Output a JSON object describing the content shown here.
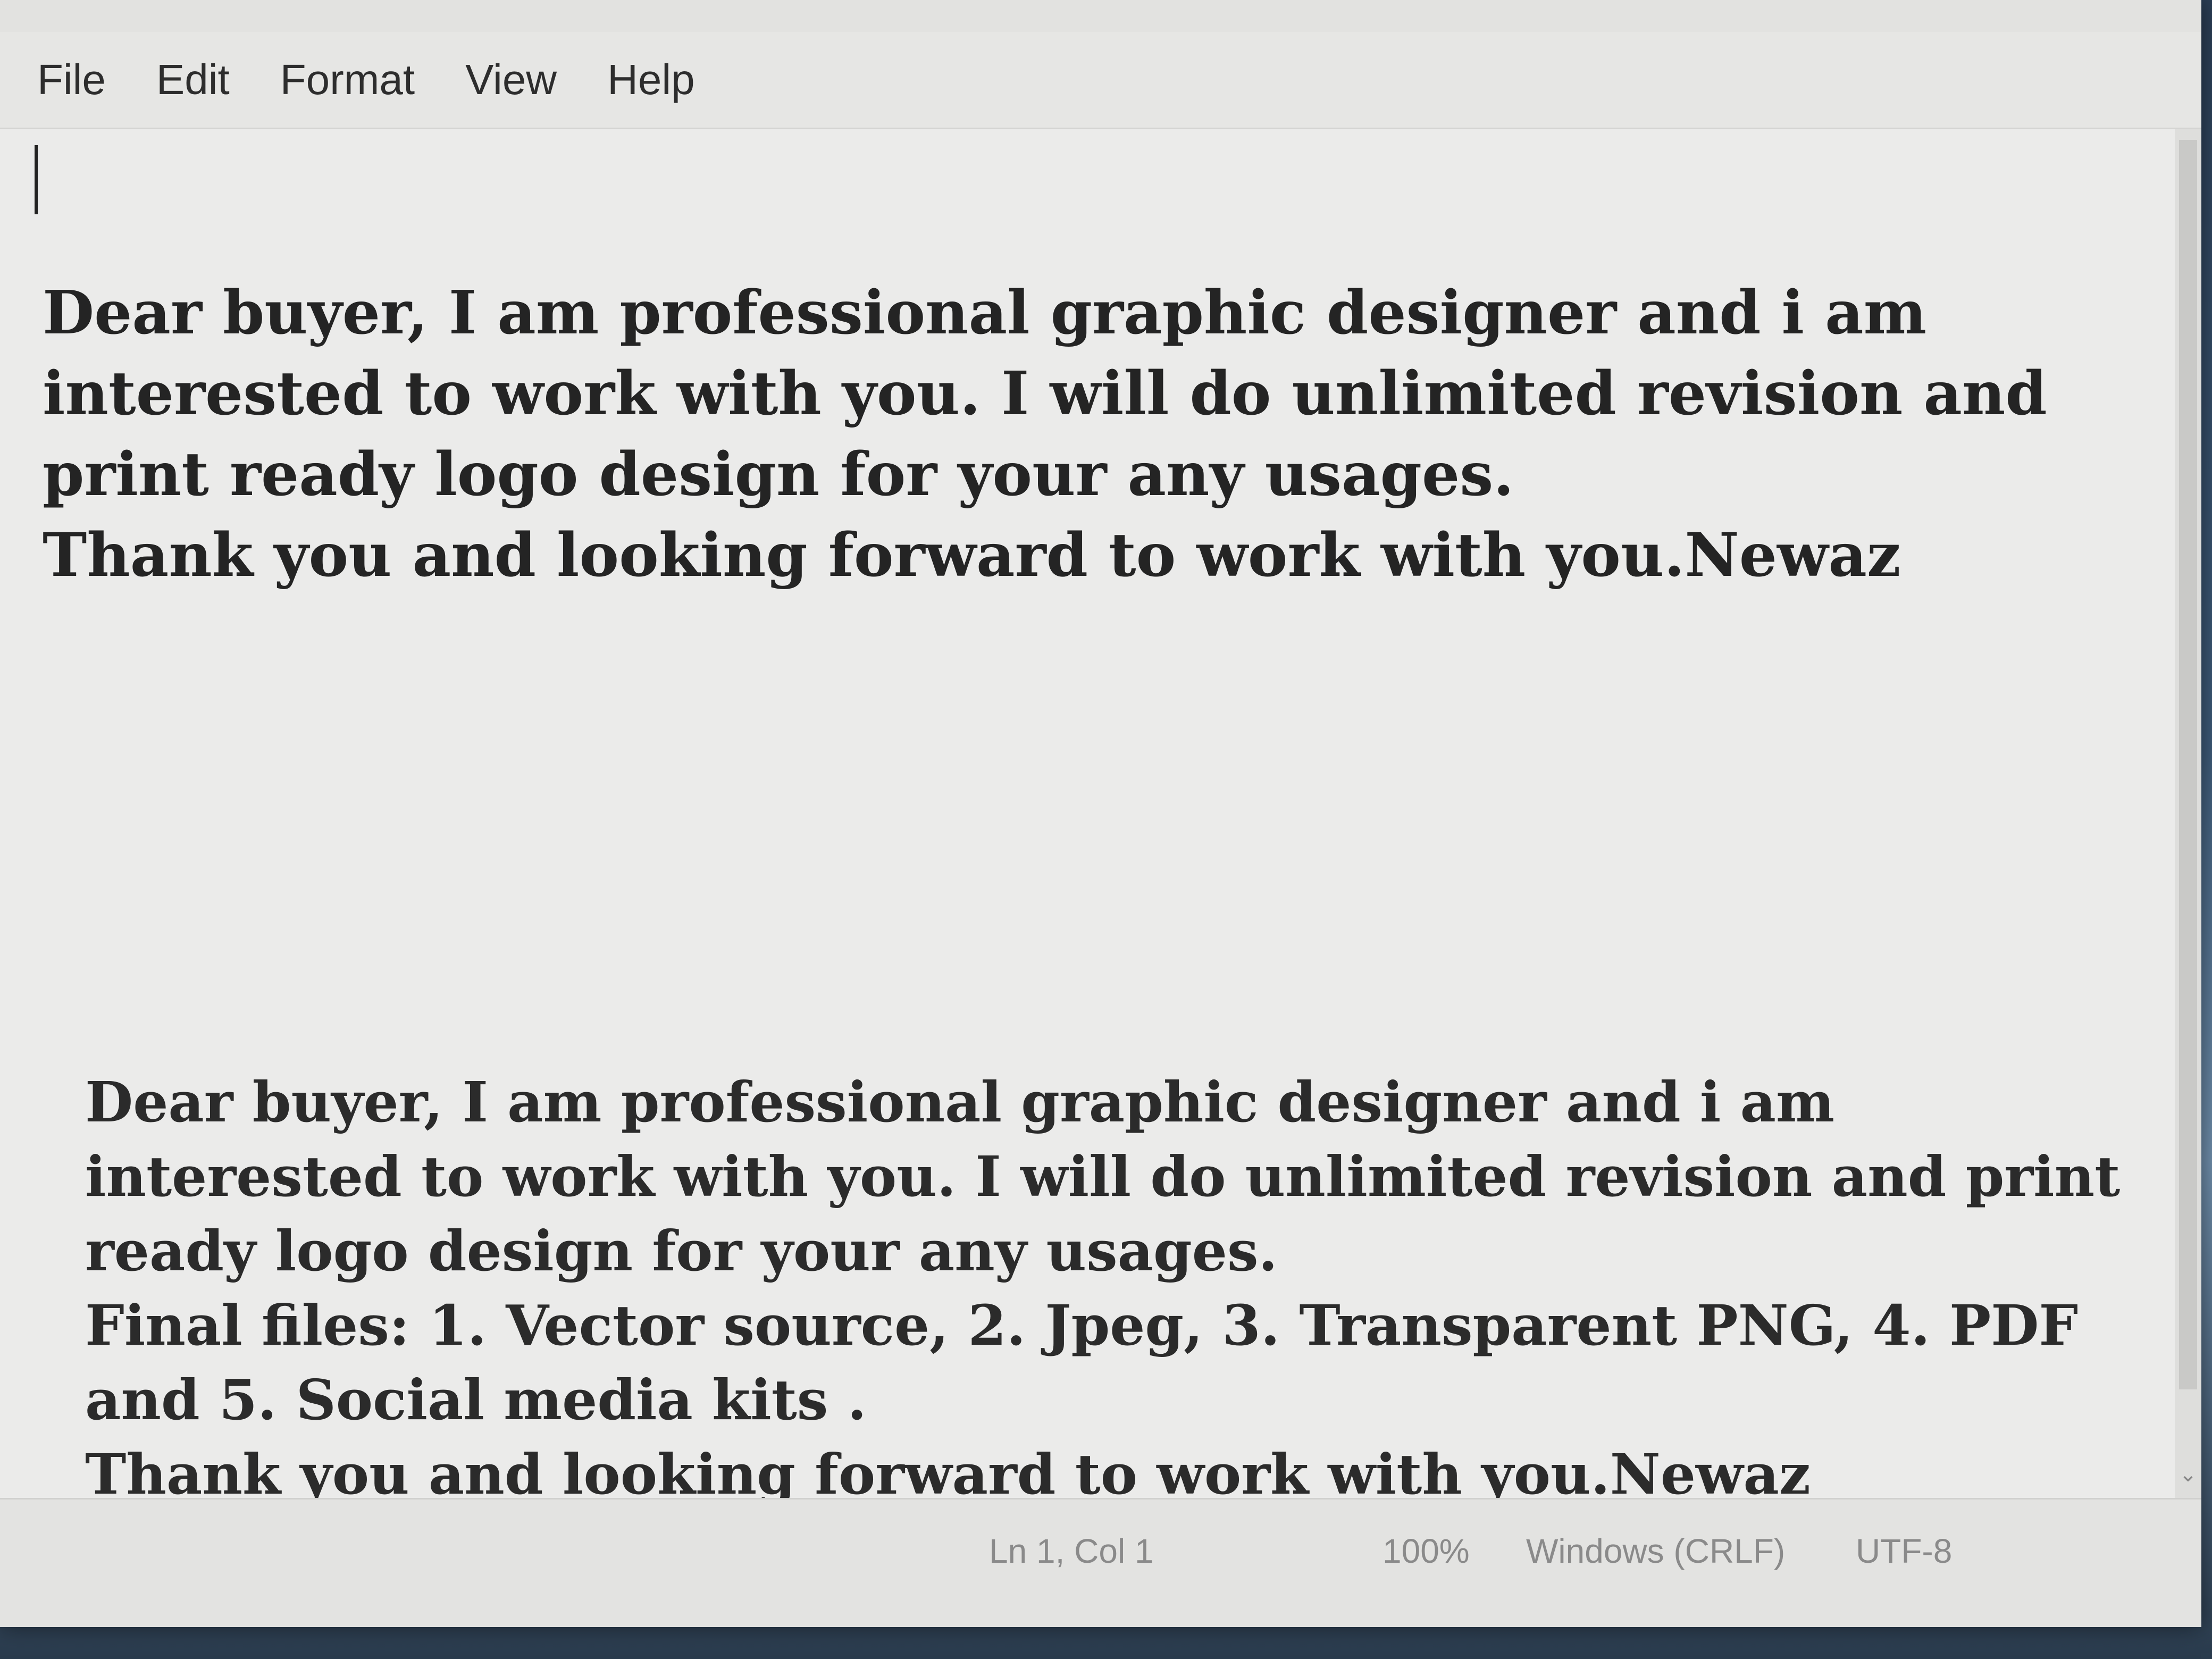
{
  "window": {
    "controls": {
      "minimize_icon": "—",
      "maximize_icon": "☐",
      "close_icon": "✕"
    }
  },
  "menubar": {
    "items": [
      {
        "label": "File"
      },
      {
        "label": "Edit"
      },
      {
        "label": "Format"
      },
      {
        "label": "View"
      },
      {
        "label": "Help"
      }
    ]
  },
  "editor": {
    "paragraph1": "Dear buyer, I am professional graphic designer and i am interested to work with you. I will do unlimited revision and print ready logo design for your any usages.\nThank you and looking forward to work with you.Newaz",
    "paragraph2": "Dear buyer, I am professional graphic designer and i am interested to work with you. I will do unlimited revision and print ready logo design for your any usages.\nFinal files: 1. Vector source, 2. Jpeg, 3. Transparent PNG, 4. PDF and 5. Social media kits .\nThank you and looking forward to work with you.Newaz"
  },
  "statusbar": {
    "position": "Ln 1, Col 1",
    "zoom": "100%",
    "line_ending": "Windows (CRLF)",
    "encoding": "UTF-8"
  }
}
